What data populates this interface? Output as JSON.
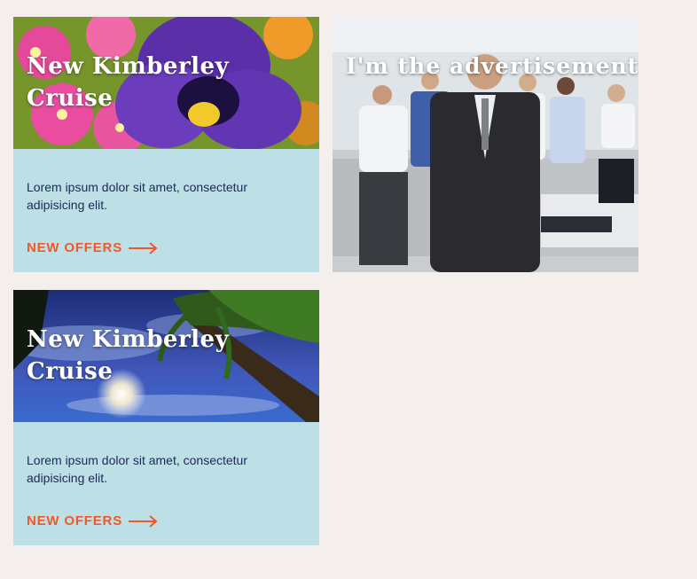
{
  "cards": [
    {
      "title": "New Kimberley Cruise",
      "text": "Lorem ipsum dolor sit amet, consectetur adipisicing elit.",
      "link_label": "NEW OFFERS",
      "image": "purple-pansy-flowers"
    },
    {
      "title": "New Kimberley Cruise",
      "text": "Lorem ipsum dolor sit amet, consectetur adipisicing elit.",
      "link_label": "NEW OFFERS",
      "image": "palm-tree-sunset-sky"
    }
  ],
  "ad": {
    "title": "I'm the advertisement",
    "image": "office-business-team"
  },
  "colors": {
    "page_bg": "#f4eeed",
    "card_bg": "#bde0e6",
    "link": "#f2572a",
    "body_text": "#1d2758"
  }
}
